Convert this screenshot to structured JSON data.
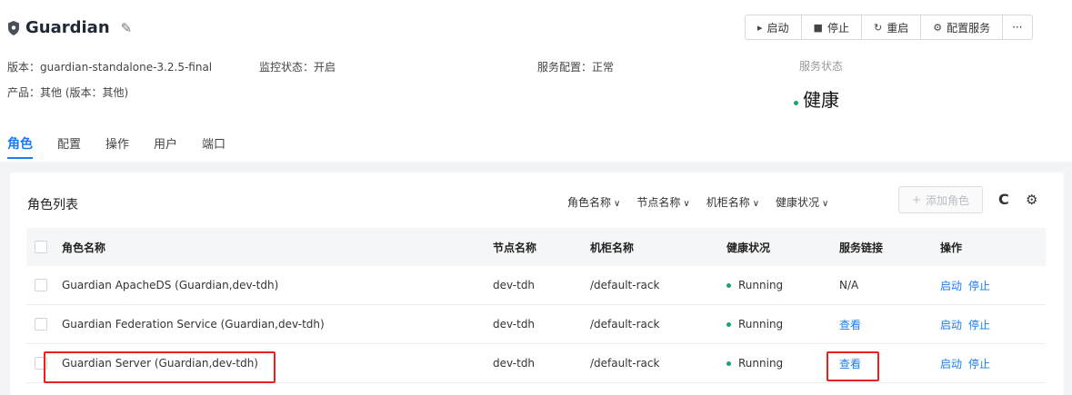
{
  "header": {
    "title": "Guardian",
    "edit_icon": "pencil-icon",
    "version": "版本：guardian-standalone-3.2.5-final",
    "monitor_status": "监控状态：开启",
    "service_config": "服务配置：正常",
    "product": "产品：其他 (版本：其他)",
    "service_status_label": "服务状态",
    "health_status": "健康",
    "health_color": "#1aa36a"
  },
  "actions": {
    "start": "启动",
    "stop": "停止",
    "restart": "重启",
    "configure": "配置服务",
    "more": "···"
  },
  "tabs": [
    {
      "label": "角色"
    },
    {
      "label": "配置"
    },
    {
      "label": "操作"
    },
    {
      "label": "用户"
    },
    {
      "label": "端口"
    }
  ],
  "role_list": {
    "title": "角色列表",
    "filters": {
      "role_name": "角色名称",
      "node_name": "节点名称",
      "rack_name": "机柜名称",
      "health": "健康状况"
    },
    "add_role": "添加角色",
    "columns": {
      "role_name": "角色名称",
      "node_name": "节点名称",
      "rack_name": "机柜名称",
      "health": "健康状况",
      "service_link": "服务链接",
      "operations": "操作"
    },
    "rows": [
      {
        "role": "Guardian ApacheDS (Guardian,dev-tdh)",
        "node": "dev-tdh",
        "rack": "/default-rack",
        "health": "Running",
        "link": "N/A",
        "start": "启动",
        "stop": "停止"
      },
      {
        "role": "Guardian Federation Service (Guardian,dev-tdh)",
        "node": "dev-tdh",
        "rack": "/default-rack",
        "health": "Running",
        "link": "查看",
        "start": "启动",
        "stop": "停止"
      },
      {
        "role": "Guardian Server (Guardian,dev-tdh)",
        "node": "dev-tdh",
        "rack": "/default-rack",
        "health": "Running",
        "link": "查看",
        "start": "启动",
        "stop": "停止"
      }
    ]
  },
  "colors": {
    "accent": "#1b7cf2",
    "running": "#1aa36a",
    "highlight": "#e8201f"
  }
}
